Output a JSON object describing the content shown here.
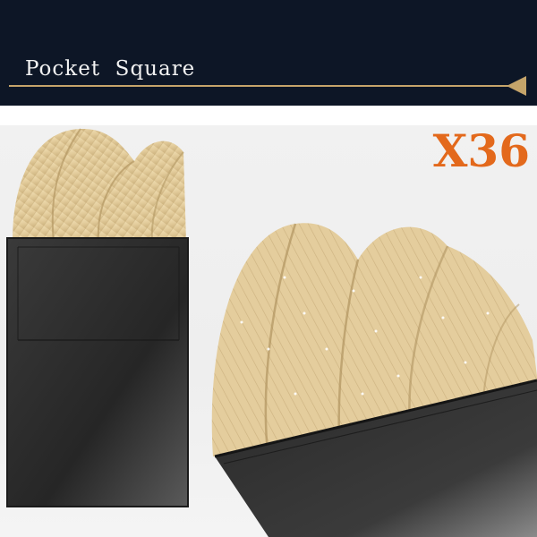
{
  "header": {
    "title": "Pocket  Square",
    "accent_color": "#c5a46a",
    "background_color": "#0d1626"
  },
  "product": {
    "quantity_label": "X36",
    "quantity_color": "#e3691c",
    "fabric_color": "#e2cb9a",
    "card_color": "#2b2b2b"
  },
  "icons": {
    "header_arrow": "left-triangle-icon"
  }
}
